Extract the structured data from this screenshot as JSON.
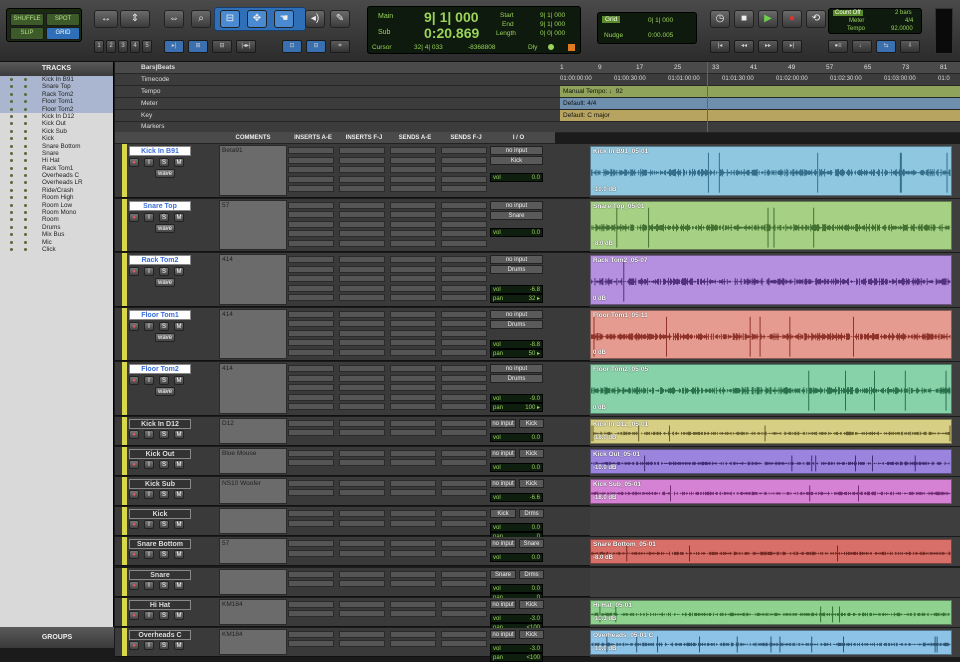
{
  "toolbar": {
    "edit_modes": {
      "shuffle": "SHUFFLE",
      "spot": "SPOT",
      "slip": "SLIP",
      "grid": "GRID"
    },
    "zoom_presets": [
      "1",
      "2",
      "3",
      "4",
      "5"
    ],
    "counter": {
      "main_label": "Main",
      "main_value": "9| 1| 000",
      "sub_label": "Sub",
      "sub_value": "0:20.869",
      "start_label": "Start",
      "start_value": "9| 1| 000",
      "end_label": "End",
      "end_value": "9| 1| 000",
      "length_label": "Length",
      "length_value": "0| 0| 000",
      "cursor_label": "Cursor",
      "cursor_value": "32| 4| 033",
      "cursor_sample": "-8368808",
      "dly_label": "Dly"
    },
    "grid": {
      "label": "Grid",
      "value": "0| 1| 000"
    },
    "nudge": {
      "label": "Nudge",
      "value": "0:00.005"
    },
    "count": {
      "label": "Count Off",
      "count_value": "2 bars",
      "meter_label": "Meter",
      "meter_value": "4/4",
      "tempo_label": "Tempo",
      "tempo_value": "92.0000"
    }
  },
  "tracks_panel": {
    "title": "TRACKS",
    "groups_label": "GROUPS",
    "items": [
      {
        "name": "Kick In B91",
        "selected": true
      },
      {
        "name": "Snare Top",
        "selected": true
      },
      {
        "name": "Rack Tom2",
        "selected": true
      },
      {
        "name": "Floor Tom1",
        "selected": true
      },
      {
        "name": "Floor Tom2",
        "selected": true
      },
      {
        "name": "Kick In D12",
        "selected": false
      },
      {
        "name": "Kick Out",
        "selected": false
      },
      {
        "name": "Kick Sub",
        "selected": false
      },
      {
        "name": "Kick",
        "selected": false
      },
      {
        "name": "Snare Bottom",
        "selected": false
      },
      {
        "name": "Snare",
        "selected": false
      },
      {
        "name": "Hi Hat",
        "selected": false
      },
      {
        "name": "Rack Tom1",
        "selected": false
      },
      {
        "name": "Overheads C",
        "selected": false
      },
      {
        "name": "Overheads LR",
        "selected": false
      },
      {
        "name": "Ride/Crash",
        "selected": false
      },
      {
        "name": "Room High",
        "selected": false
      },
      {
        "name": "Room Low",
        "selected": false
      },
      {
        "name": "Room Mono",
        "selected": false
      },
      {
        "name": "Room",
        "selected": false
      },
      {
        "name": "Drums",
        "selected": false
      },
      {
        "name": "Mix Bus",
        "selected": false
      },
      {
        "name": "Mic",
        "selected": false
      },
      {
        "name": "Click",
        "selected": false
      }
    ]
  },
  "rulers": {
    "bars_beats": "Bars|Beats",
    "timecode": "Timecode",
    "tempo": "Tempo",
    "meter": "Meter",
    "key": "Key",
    "markers": "Markers",
    "bar_numbers": [
      "1",
      "9",
      "17",
      "25",
      "33",
      "41",
      "49",
      "57",
      "65",
      "73",
      "81"
    ],
    "timecodes": [
      "01:00:00:00",
      "01:00:30:00",
      "01:01:00:00",
      "01:01:30:00",
      "01:02:00:00",
      "01:02:30:00",
      "01:03:00:00",
      "01:0"
    ],
    "tempo_marker": "Manual Tempo: ♩92",
    "meter_marker": "Default: 4/4",
    "key_marker": "Default: C major"
  },
  "column_headers": {
    "comments": "COMMENTS",
    "inserts_ae": "INSERTS A-E",
    "inserts_fj": "INSERTS F-J",
    "sends_ae": "SENDS A-E",
    "sends_fj": "SENDS F-J",
    "io": "I / O"
  },
  "tracks": [
    {
      "name": "Kick In B91",
      "comment": "Beta91",
      "input": "no input",
      "output": "Kick",
      "vol": "0.0",
      "clip": "Kick In B91_05-01",
      "clip_vol": "-10.0 dB",
      "color": "#8ec7df",
      "wave": "#1e5a78",
      "big": true
    },
    {
      "name": "Snare Top",
      "comment": "57",
      "input": "no input",
      "output": "Snare",
      "vol": "0.0",
      "clip": "Snare Top_05-01",
      "clip_vol": "-8.0 dB",
      "color": "#a6d185",
      "wave": "#2b5a1e",
      "big": true
    },
    {
      "name": "Rack Tom2",
      "comment": "414",
      "input": "no input",
      "output": "Drums",
      "vol": "-6.8",
      "pan": "32 ▸",
      "clip": "Rack Tom2_05-07",
      "clip_vol": "0 dB",
      "color": "#b690e0",
      "wave": "#3a1a66",
      "big": true
    },
    {
      "name": "Floor Tom1",
      "comment": "414",
      "input": "no input",
      "output": "Drums",
      "vol": "-8.8",
      "pan": "50 ▸",
      "clip": "Floor Tom1_05-11",
      "clip_vol": "0 dB",
      "color": "#e59b8f",
      "wave": "#7a1a12",
      "big": true
    },
    {
      "name": "Floor Tom2",
      "comment": "414",
      "input": "no input",
      "output": "Drums",
      "vol": "-9.0",
      "pan": "100 ▸",
      "clip": "Floor Tom2_05-05",
      "clip_vol": "0 dB",
      "color": "#88d2aa",
      "wave": "#145a36",
      "big": true
    },
    {
      "name": "Kick In D12",
      "comment": "D12",
      "input": "no input",
      "output": "Kick",
      "vol": "0.0",
      "clip": "Kick In D12_05-01",
      "clip_vol": "-18.0 dB",
      "color": "#d7cf83",
      "wave": "#4a421a",
      "big": false
    },
    {
      "name": "Kick Out",
      "comment": "Blue Mouse",
      "input": "no input",
      "output": "Kick",
      "vol": "0.0",
      "clip": "Kick Out_05-01",
      "clip_vol": "-10.0 dB",
      "color": "#9a84dd",
      "wave": "#2a1a5a",
      "big": false
    },
    {
      "name": "Kick Sub",
      "comment": "NS10 Woofer",
      "input": "no input",
      "output": "Kick",
      "vol": "-6.6",
      "clip": "Kick Sub_05-01",
      "clip_vol": "-18.0 dB",
      "color": "#d582d4",
      "wave": "#5a1a5a",
      "big": false
    },
    {
      "name": "Kick",
      "comment": "",
      "input": "Kick",
      "output": "Drms",
      "vol": "0.0",
      "pan": "0",
      "clip": "",
      "clip_vol": "",
      "color": "",
      "wave": "",
      "big": false
    },
    {
      "name": "Snare Bottom",
      "comment": "57",
      "input": "no input",
      "output": "Snare",
      "vol": "0.0",
      "clip": "Snare Bottom_05-01",
      "clip_vol": "-8.0 dB",
      "color": "#d86f68",
      "wave": "#5a1a14",
      "big": false
    },
    {
      "name": "Snare",
      "comment": "",
      "input": "Snare",
      "output": "Drms",
      "vol": "0.0",
      "pan": "0",
      "clip": "",
      "clip_vol": "",
      "color": "",
      "wave": "",
      "big": false
    },
    {
      "name": "Hi Hat",
      "comment": "KM184",
      "input": "no input",
      "output": "Kick",
      "vol": "-3.0",
      "pan": "<100",
      "clip": "Hi Hat_05-01",
      "clip_vol": "-10.3 dB",
      "color": "#8fd18e",
      "wave": "#1e5a1e",
      "big": false
    },
    {
      "name": "Overheads C",
      "comment": "KM184",
      "input": "no input",
      "output": "Kick",
      "vol": "-3.0",
      "pan": "<100",
      "clip": "Overheads_05-01 C",
      "clip_vol": "-10.0 dB",
      "color": "#8cc3e6",
      "wave": "#1a3e5a",
      "big": false
    }
  ]
}
